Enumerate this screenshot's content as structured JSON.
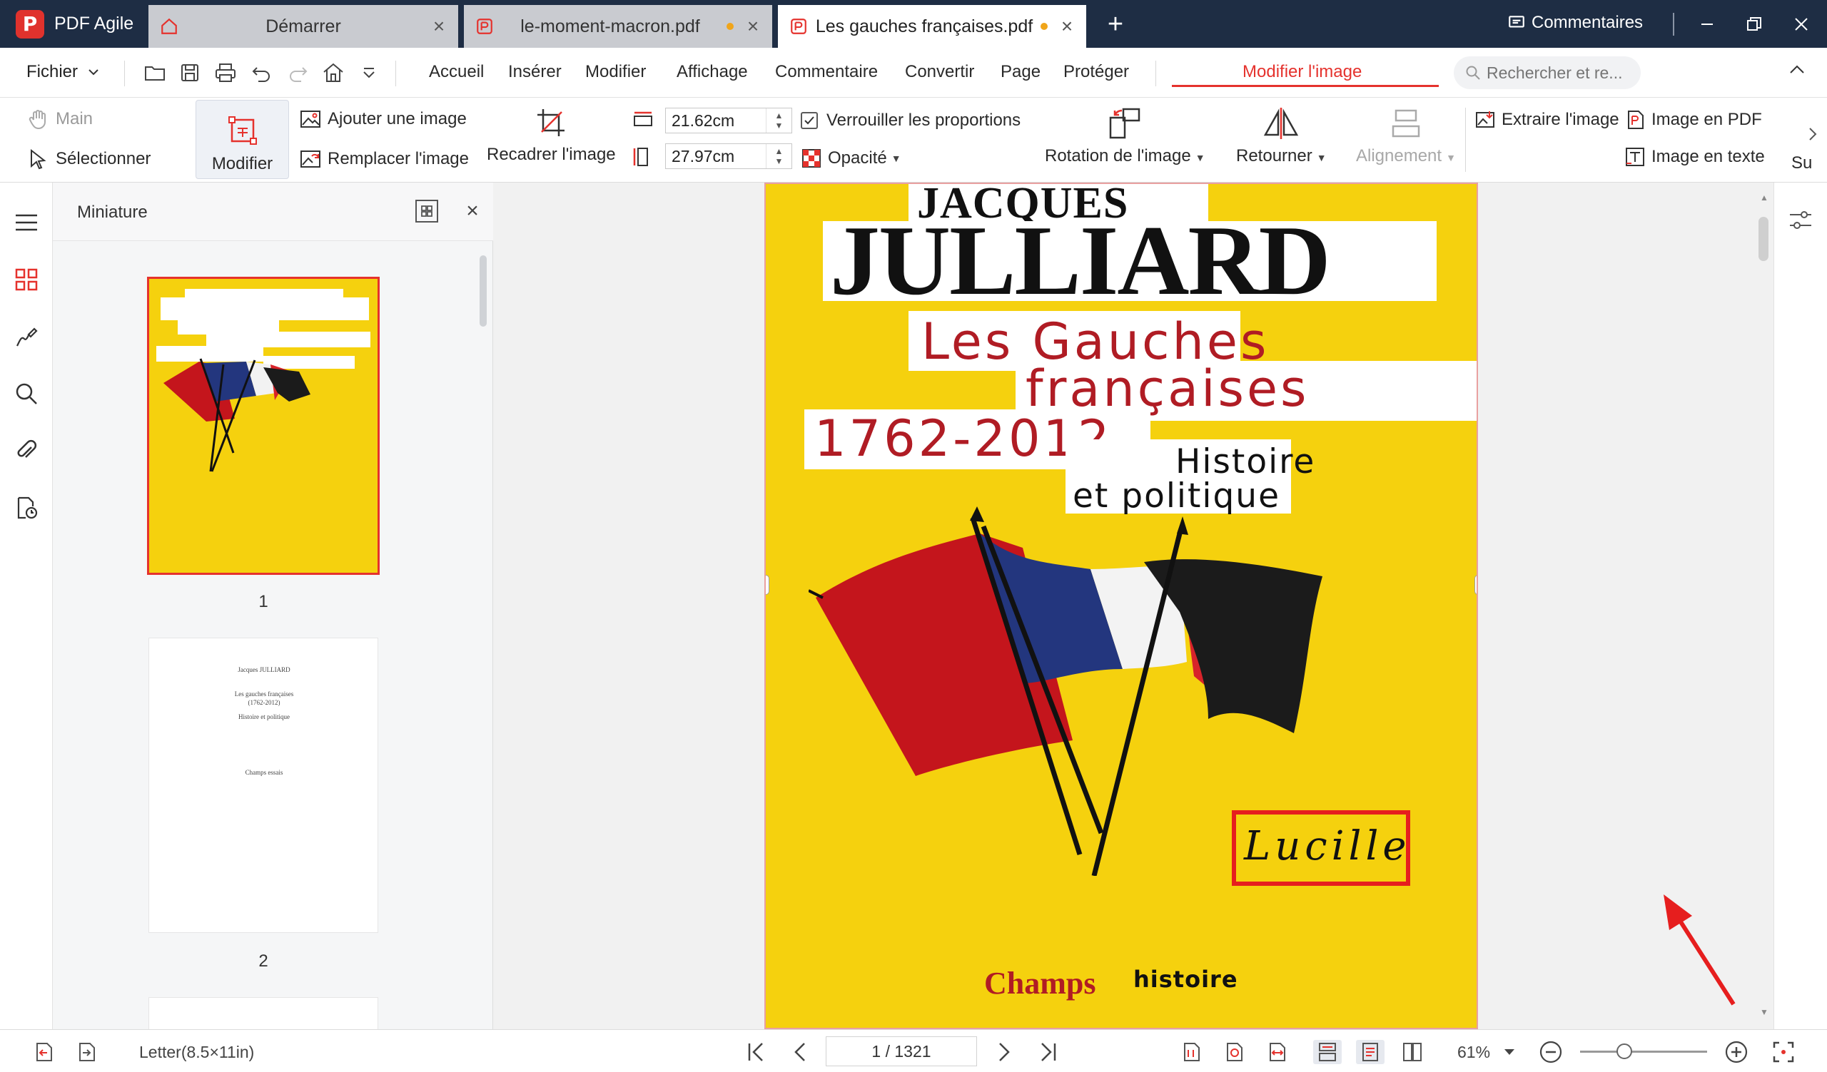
{
  "app": {
    "name": "PDF Agile"
  },
  "tabs": [
    {
      "label": "Démarrer",
      "kind": "home",
      "active": false,
      "unsaved": false
    },
    {
      "label": "le-moment-macron.pdf",
      "kind": "pdf",
      "active": false,
      "unsaved": true
    },
    {
      "label": "Les gauches françaises.pdf",
      "kind": "pdf",
      "active": true,
      "unsaved": true
    }
  ],
  "titlebar": {
    "comments_label": "Commentaires"
  },
  "menu": {
    "file_label": "Fichier",
    "items": [
      "Accueil",
      "Insérer",
      "Modifier",
      "Affichage",
      "Commentaire",
      "Convertir",
      "Page",
      "Protéger"
    ],
    "active_context": "Modifier l'image",
    "search_placeholder": "Rechercher et re..."
  },
  "ribbon": {
    "hand_label": "Main",
    "select_label": "Sélectionner",
    "edit_label": "Modifier",
    "add_image_label": "Ajouter une image",
    "replace_image_label": "Remplacer l'image",
    "crop_label": "Recadrer l'image",
    "width_value": "21.62cm",
    "height_value": "27.97cm",
    "lock_ratio_label": "Verrouiller les proportions",
    "lock_ratio_checked": true,
    "opacity_label": "Opacité",
    "rotate_label": "Rotation de l'image",
    "flip_label": "Retourner",
    "align_label": "Alignement",
    "extract_label": "Extraire l'image",
    "to_pdf_label": "Image en PDF",
    "to_text_label": "Image en texte",
    "overflow_label": "Su"
  },
  "thumbnails": {
    "title": "Miniature",
    "pages": [
      {
        "number": "1",
        "selected": true
      },
      {
        "number": "2",
        "selected": false
      }
    ],
    "page2_lines": [
      "Jacques JULLIARD",
      "Les gauches françaises",
      "(1762-2012)",
      "Histoire et politique",
      "Champs essais"
    ]
  },
  "cover": {
    "author_first": "JACQUES",
    "author_last": "JULLIARD",
    "title_line1": "Les Gauches",
    "title_line2": "françaises",
    "years": "1762-2012",
    "subtitle_line1": "Histoire",
    "subtitle_line2": "et politique",
    "signature": "Lucille",
    "publisher_bold": "Champs",
    "publisher_series": "histoire"
  },
  "statusbar": {
    "page_size": "Letter(8.5×11in)",
    "page_indicator": "1 / 1321",
    "zoom": "61%",
    "zoom_fraction": 0.35
  },
  "colors": {
    "titlebar": "#1e2d44",
    "accent": "#e5322d",
    "cover_yellow": "#f5d10e",
    "cover_red": "#b01c24",
    "annotation_red": "#e61e1e"
  }
}
